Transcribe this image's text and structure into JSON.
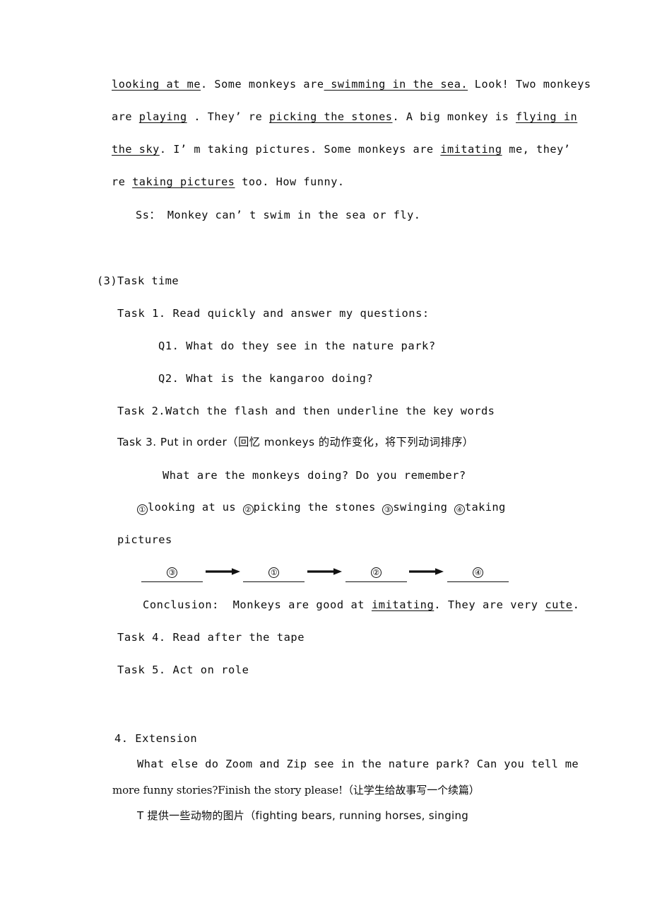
{
  "document": {
    "type": "lesson-plan-page",
    "language": "English with Simplified Chinese annotations"
  },
  "dialogue": {
    "line1_a": "looking at me",
    "line1_b": ". Some monkeys are",
    "line1_c": " swimming in the sea.",
    "line1_d": " Look! Two monkeys",
    "line2_a": "are ",
    "line2_b": "playing",
    "line2_c": " . They’ re ",
    "line2_d": "picking the stones",
    "line2_e": ". A big monkey is ",
    "line2_f": "flying in",
    "line3_a": "the sky",
    "line3_b": ". I’ m taking pictures. Some monkeys are ",
    "line3_c": "imitating",
    "line3_d": " me, they’",
    "line4_a": "re ",
    "line4_b": "taking pictures",
    "line4_c": " too. How funny.",
    "line5": "Ss： Monkey can’ t swim in the sea or fly."
  },
  "task_time": {
    "heading": "(3)Task time",
    "task1": "Task 1. Read quickly and answer my questions:",
    "q1": "Q1. What do they see in the nature park?",
    "q2": "Q2. What is the kangaroo doing?",
    "task2": "Task 2.Watch the flash and then underline the key words",
    "task3_en": "Task 3. Put in order（回忆 monkeys 的动作变化，将下列动词排序）",
    "task3_prompt": "What are the monkeys doing? Do you remember?",
    "options_line1_item1": "looking at us",
    "options_line1_item2": "picking the stones",
    "options_line1_item3": "swinging",
    "options_line1_item4": "taking",
    "options_line2": "pictures",
    "circled": [
      "①",
      "②",
      "③",
      "④"
    ],
    "order_sequence": [
      "③",
      "①",
      "②",
      "④"
    ],
    "conclusion_a": "Conclusion:  Monkeys are good at ",
    "conclusion_b": "imitating",
    "conclusion_c": ". They are very ",
    "conclusion_d": "cute",
    "conclusion_e": ".",
    "task4": "Task 4. Read after the tape",
    "task5": "Task 5. Act on role"
  },
  "extension": {
    "heading": "4. Extension",
    "line1": "What else do Zoom and Zip see in the nature park? Can you tell me",
    "line2": "more funny stories?Finish the story please!（让学生给故事写一个续篇）",
    "line3": "T 提供一些动物的图片（fighting bears, running horses, singing"
  },
  "colors": {
    "page_background": "#ffffff",
    "text": "#0d0d0d",
    "rule": "#111111"
  }
}
